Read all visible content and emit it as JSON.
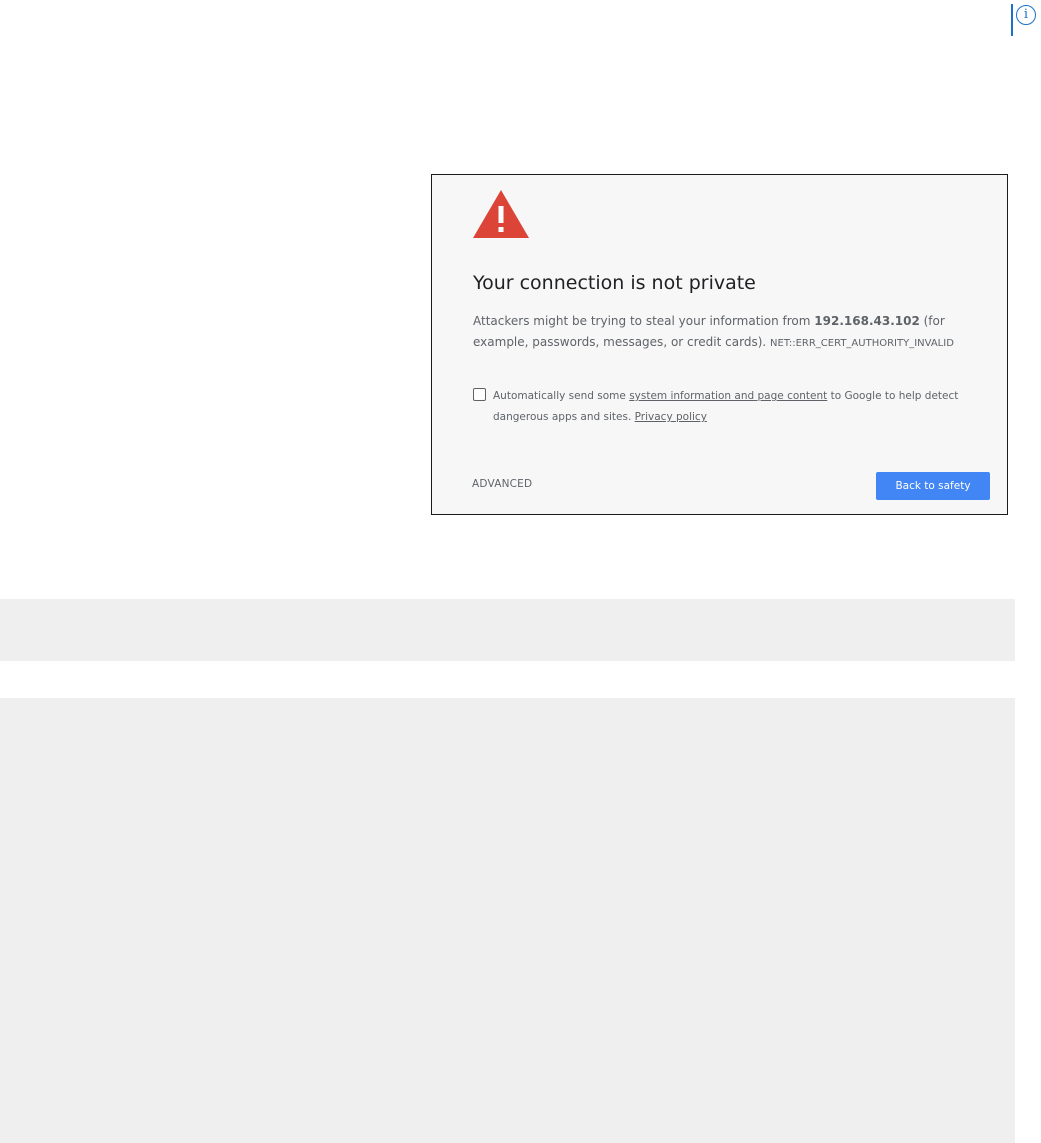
{
  "info_marker": {
    "icon": "info-icon",
    "glyph": "i",
    "color": "#1a73c8"
  },
  "interstitial": {
    "icon": "warning-triangle-icon",
    "icon_color": "#db4437",
    "heading": "Your connection is not private",
    "explanation_prefix": "Attackers might be trying to steal your information from ",
    "host": "192.168.43.102",
    "explanation_suffix": " (for example, passwords, messages, or credit cards).",
    "error_code": "NET::ERR_CERT_AUTHORITY_INVALID",
    "optin": {
      "checked": false,
      "prefix": "Automatically send some ",
      "link_text": "system information and page content",
      "middle": " to Google to help detect dangerous apps and sites. ",
      "privacy_link": "Privacy policy"
    },
    "advanced_label": "ADVANCED",
    "primary_button_label": "Back to safety",
    "primary_color": "#4285f4",
    "background_color": "#f7f7f7"
  },
  "panels": {
    "background_color": "#efefef"
  }
}
